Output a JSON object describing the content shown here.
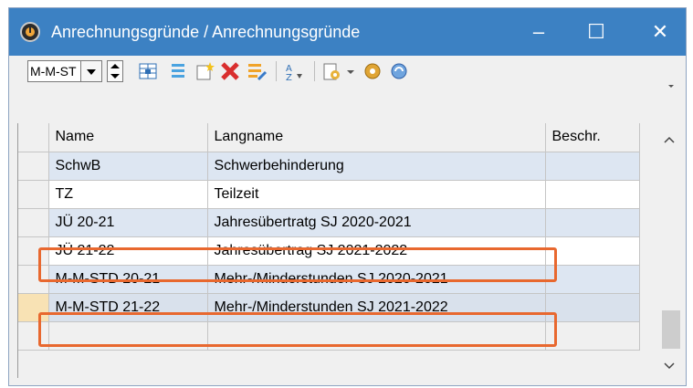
{
  "window": {
    "title": "Anrechnungsgründe / Anrechnungsgründe",
    "controls": {
      "minimize": "‒",
      "maximize": "☐",
      "close": "✕"
    }
  },
  "toolbar": {
    "selector_value": "M-M-ST",
    "icons": [
      "grid-add-icon",
      "columns-icon",
      "new-record-icon",
      "delete-icon",
      "list-edit-icon",
      "sort-icon",
      "report-icon",
      "settings-gear-icon",
      "refresh-icon"
    ]
  },
  "table": {
    "columns": [
      "Name",
      "Langname",
      "Beschr."
    ],
    "rows": [
      {
        "name": "SchwB",
        "langname": "Schwerbehinderung",
        "beschr": ""
      },
      {
        "name": "TZ",
        "langname": "Teilzeit",
        "beschr": ""
      },
      {
        "name": "JÜ 20-21",
        "langname": "Jahresübertratg SJ 2020-2021",
        "beschr": ""
      },
      {
        "name": "JÜ 21-22",
        "langname": "Jahresübertrag SJ 2021-2022",
        "beschr": ""
      },
      {
        "name": "M-M-STD 20-21",
        "langname": "Mehr-/Minderstunden SJ 2020-2021",
        "beschr": ""
      },
      {
        "name": "M-M-STD 21-22",
        "langname": "Mehr-/Minderstunden SJ 2021-2022",
        "beschr": ""
      }
    ]
  },
  "colors": {
    "titlebar": "#3c81c3",
    "highlight": "#e8682f",
    "row_alt": "#dde6f2",
    "current_marker": "#f8e2b4"
  }
}
